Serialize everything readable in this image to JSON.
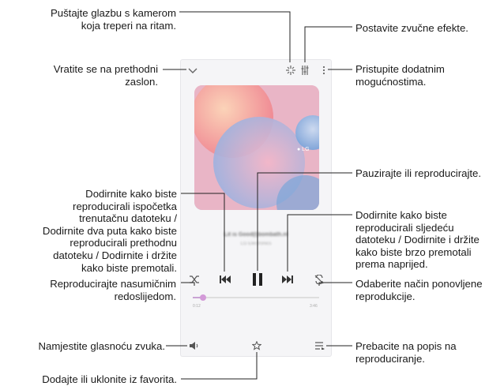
{
  "callouts": {
    "flash": "Puštajte glazbu s kamerom\nkoja treperi na ritam.",
    "effects": "Postavite zvučne efekte.",
    "back": "Vratite se na prethodni\nzaslon.",
    "more": "Pristupite dodatnim\nmogućnostima.",
    "pause": "Pauzirajte ili reproducirajte.",
    "previous": "Dodirnite kako biste\nreproducirali ispočetka\ntrenutačnu datoteku /\nDodirnite dva puta kako biste\nreproducirali prethodnu\ndatoteku / Dodirnite i držite\nkako biste premotali.",
    "next": "Dodirnite kako biste\nreproducirali sljedeću\ndatoteku / Dodirnite i držite\nkako biste brzo premotali\nprema naprijed.",
    "shuffle": "Reproducirajte nasumičnim\nredoslijedom.",
    "repeat": "Odaberite način ponovljene\nreprodukcije.",
    "volume": "Namjestite glasnoću zvuka.",
    "playlist": "Prebacite na popis na\nreproduciranje.",
    "favorite": "Dodajte ili uklonite iz favorita."
  },
  "player": {
    "track_title": "Lit is Good(l)bombath.nl",
    "track_artist": "LG Electronics",
    "album_badge": "● LG",
    "time_elapsed": "0:12",
    "time_total": "3:46",
    "progress_fraction": 0.08
  },
  "icons": {
    "back": "chevron-down-icon",
    "flash": "flash-sparkle-icon",
    "effects": "equalizer-icon",
    "more": "more-vert-icon",
    "shuffle": "shuffle-icon",
    "previous": "skip-previous-icon",
    "pause": "pause-icon",
    "next": "skip-next-icon",
    "repeat": "repeat-icon",
    "volume": "volume-icon",
    "favorite": "star-icon",
    "playlist": "playlist-icon"
  },
  "colors": {
    "line": "#222222",
    "screen_bg": "#f5f5f7",
    "accent": "#d39ad8"
  }
}
